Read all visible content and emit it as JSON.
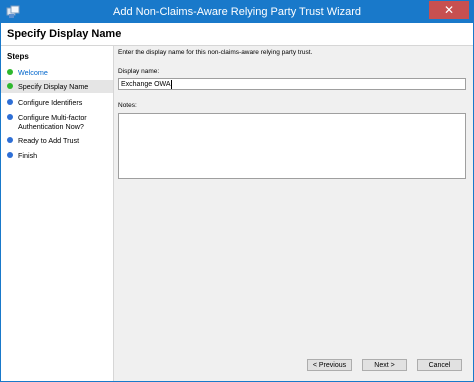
{
  "window": {
    "title": "Add Non-Claims-Aware Relying Party Trust Wizard",
    "close_symbol": "✕",
    "icon": "wizard-app-icon"
  },
  "header": {
    "title": "Specify Display Name"
  },
  "sidebar": {
    "title": "Steps",
    "items": [
      {
        "label": "Welcome",
        "status": "complete",
        "color": "#2eb82e"
      },
      {
        "label": "Specify Display Name",
        "status": "current",
        "color": "#2eb82e"
      },
      {
        "label": "Configure Identifiers",
        "status": "pending",
        "color": "#2e6fd6"
      },
      {
        "label": "Configure Multi-factor Authentication Now?",
        "status": "pending",
        "color": "#2e6fd6"
      },
      {
        "label": "Ready to Add Trust",
        "status": "pending",
        "color": "#2e6fd6"
      },
      {
        "label": "Finish",
        "status": "pending",
        "color": "#2e6fd6"
      }
    ]
  },
  "main": {
    "description": "Enter the display name for this non-claims-aware relying party trust.",
    "display_name_label": "Display name:",
    "display_name_value": "Exchange OWA",
    "notes_label": "Notes:",
    "notes_value": ""
  },
  "buttons": {
    "previous": "< Previous",
    "next": "Next >",
    "cancel": "Cancel"
  },
  "colors": {
    "titlebar": "#1979ca",
    "close": "#c75050",
    "step_complete": "#2eb82e",
    "step_pending": "#2e6fd6"
  }
}
